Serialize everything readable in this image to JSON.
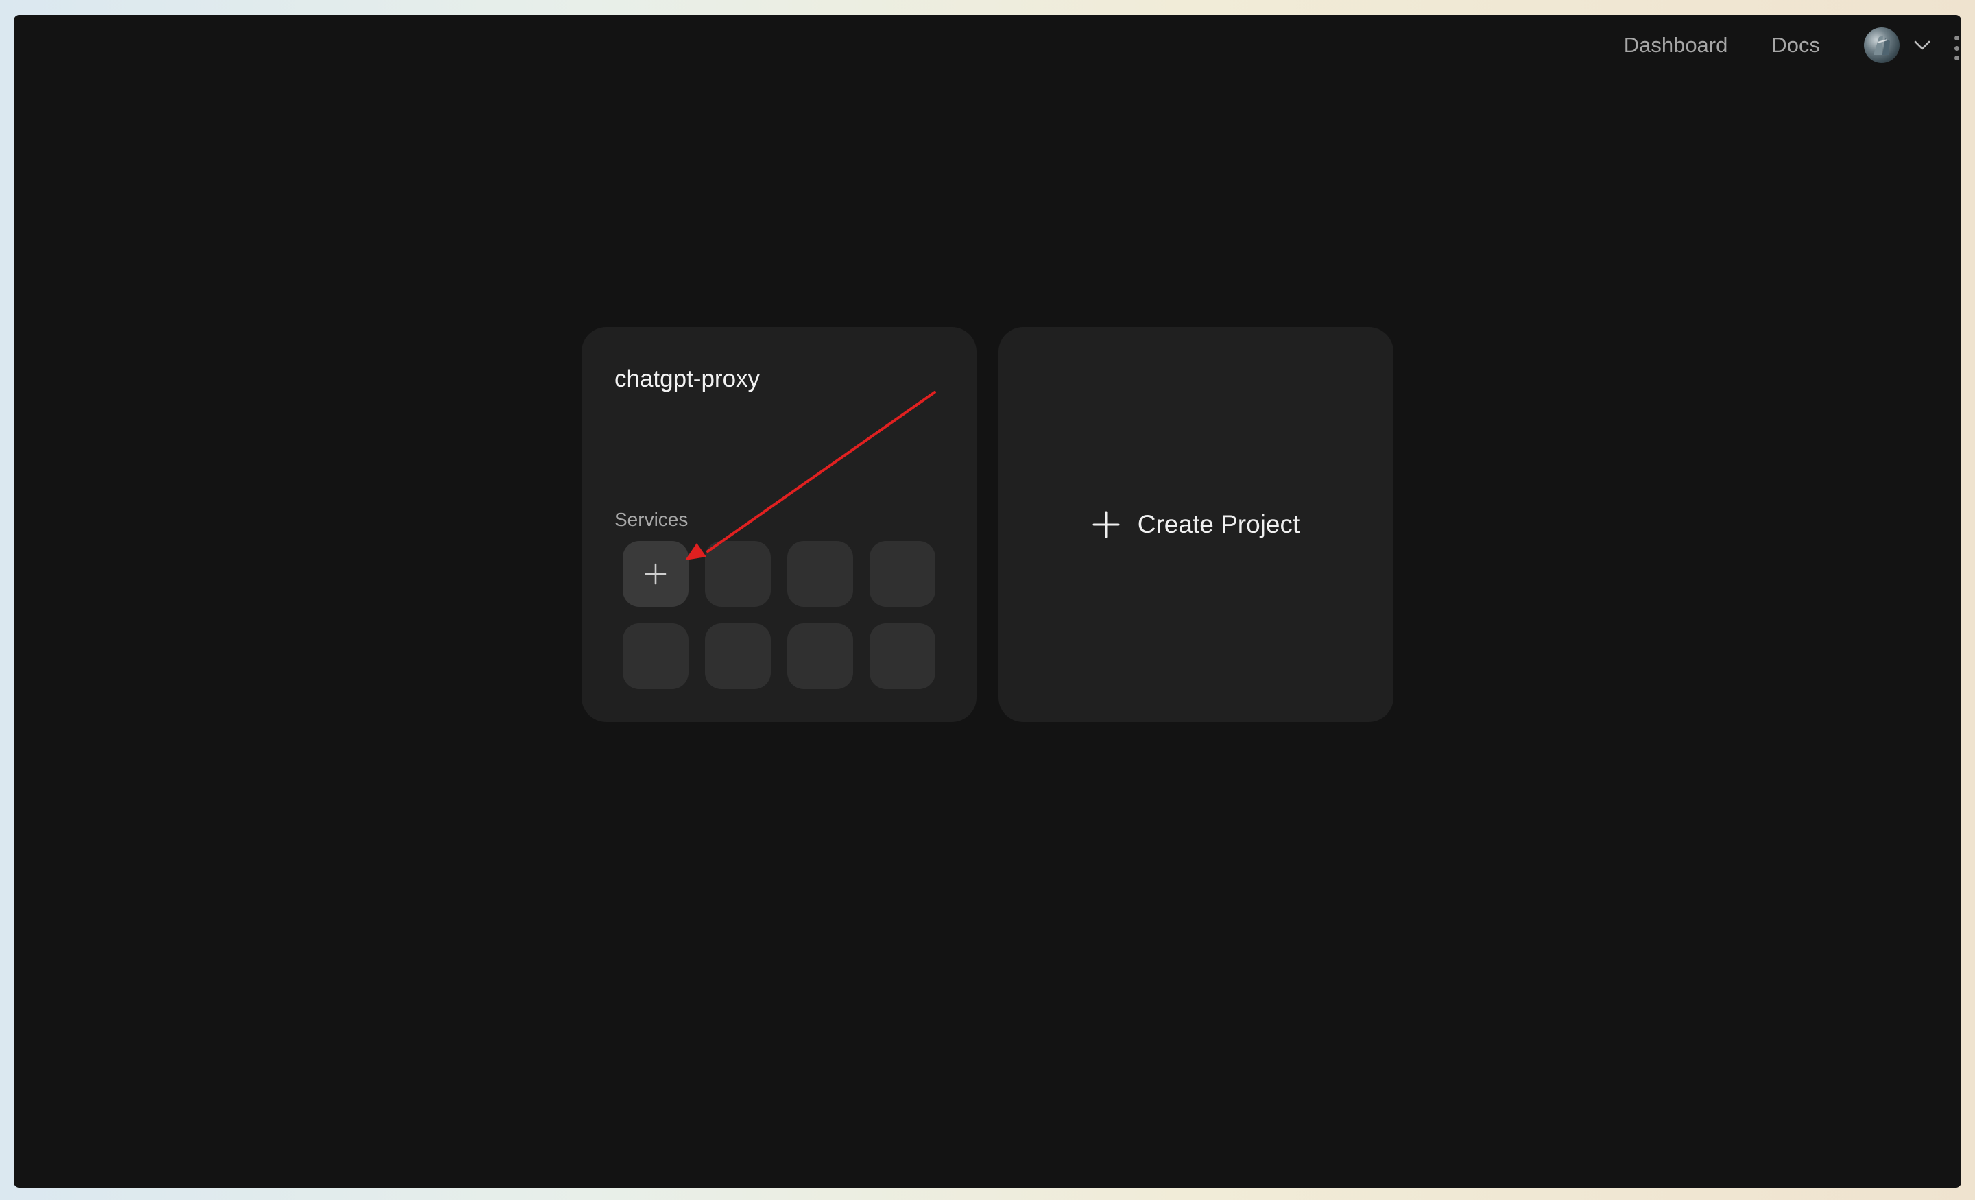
{
  "nav": {
    "dashboard_label": "Dashboard",
    "docs_label": "Docs"
  },
  "project": {
    "title": "chatgpt-proxy",
    "services_label": "Services",
    "empty_service_slots": 7
  },
  "create": {
    "label": "Create Project"
  },
  "colors": {
    "window_bg": "#131313",
    "card_bg": "#202020",
    "slot_bg": "#303030",
    "annotation_arrow": "#e02020"
  },
  "icons": {
    "add_service": "plus-icon",
    "create_project": "plus-icon",
    "account_menu": "chevron-down-icon",
    "annotation": "red-arrow-annotation"
  }
}
